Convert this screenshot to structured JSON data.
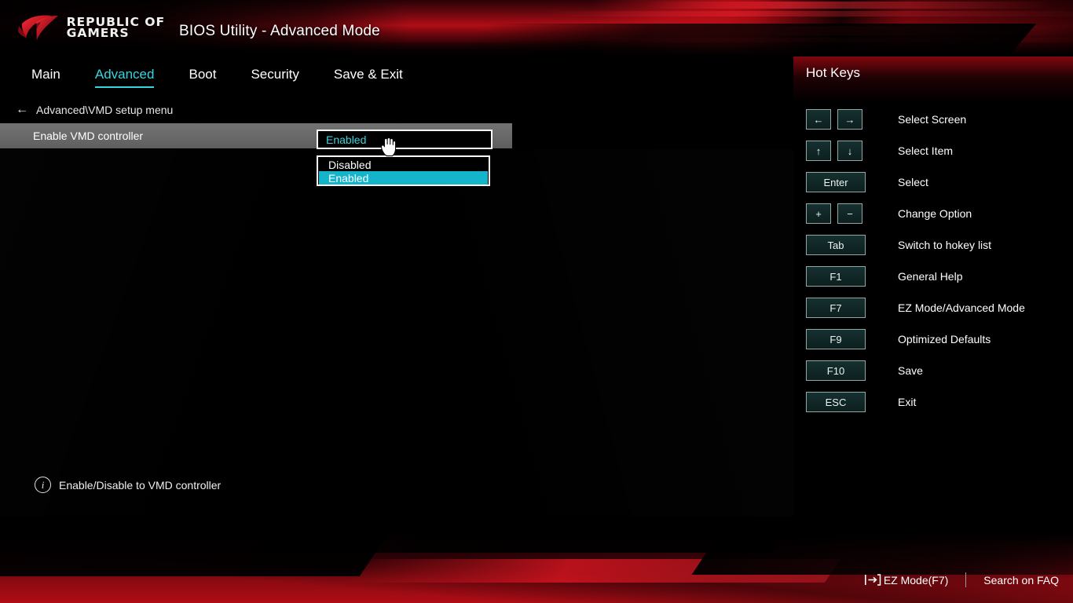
{
  "brand": {
    "logo_line1": "REPUBLIC OF",
    "logo_line2": "GAMERS",
    "logo_icon": "rog-eye-logo"
  },
  "header": {
    "title": "BIOS Utility - Advanced Mode"
  },
  "nav": {
    "tabs": [
      {
        "label": "Main",
        "active": false
      },
      {
        "label": "Advanced",
        "active": true
      },
      {
        "label": "Boot",
        "active": false
      },
      {
        "label": "Security",
        "active": false
      },
      {
        "label": "Save & Exit",
        "active": false
      }
    ]
  },
  "breadcrumb": {
    "back_icon": "arrow-left-icon",
    "path": "Advanced\\VMD setup menu"
  },
  "setting": {
    "label": "Enable VMD controller",
    "value": "Enabled",
    "options": [
      {
        "label": "Disabled",
        "selected": false
      },
      {
        "label": "Enabled",
        "selected": true
      }
    ],
    "cursor_icon": "hand-pointer-cursor"
  },
  "hotkeys_panel": {
    "title": "Hot Keys",
    "rows": [
      {
        "keys": [
          "←",
          "→"
        ],
        "desc": "Select Screen",
        "style": "narrow"
      },
      {
        "keys": [
          "↑",
          "↓"
        ],
        "desc": "Select Item",
        "style": "narrow"
      },
      {
        "keys": [
          "Enter"
        ],
        "desc": "Select",
        "style": "wide"
      },
      {
        "keys": [
          "+",
          "−"
        ],
        "desc": "Change Option",
        "style": "narrow"
      },
      {
        "keys": [
          "Tab"
        ],
        "desc": "Switch to hokey list",
        "style": "wide"
      },
      {
        "keys": [
          "F1"
        ],
        "desc": "General Help",
        "style": "wide"
      },
      {
        "keys": [
          "F7"
        ],
        "desc": "EZ Mode/Advanced Mode",
        "style": "wide"
      },
      {
        "keys": [
          "F9"
        ],
        "desc": "Optimized Defaults",
        "style": "wide"
      },
      {
        "keys": [
          "F10"
        ],
        "desc": "Save",
        "style": "wide"
      },
      {
        "keys": [
          "ESC"
        ],
        "desc": "Exit",
        "style": "wide"
      }
    ]
  },
  "help": {
    "icon": "info-circle-icon",
    "text": "Enable/Disable to VMD controller"
  },
  "footer": {
    "ez_mode_icon": "exit-arrow-icon",
    "ez_mode_label": "EZ Mode(F7)",
    "search_faq_label": "Search on FAQ"
  },
  "colors": {
    "accent_cyan": "#35d6e0",
    "highlight_cyan": "#14b4cb",
    "rog_red": "#b00d16",
    "row_gray": "#6a6a6a"
  }
}
